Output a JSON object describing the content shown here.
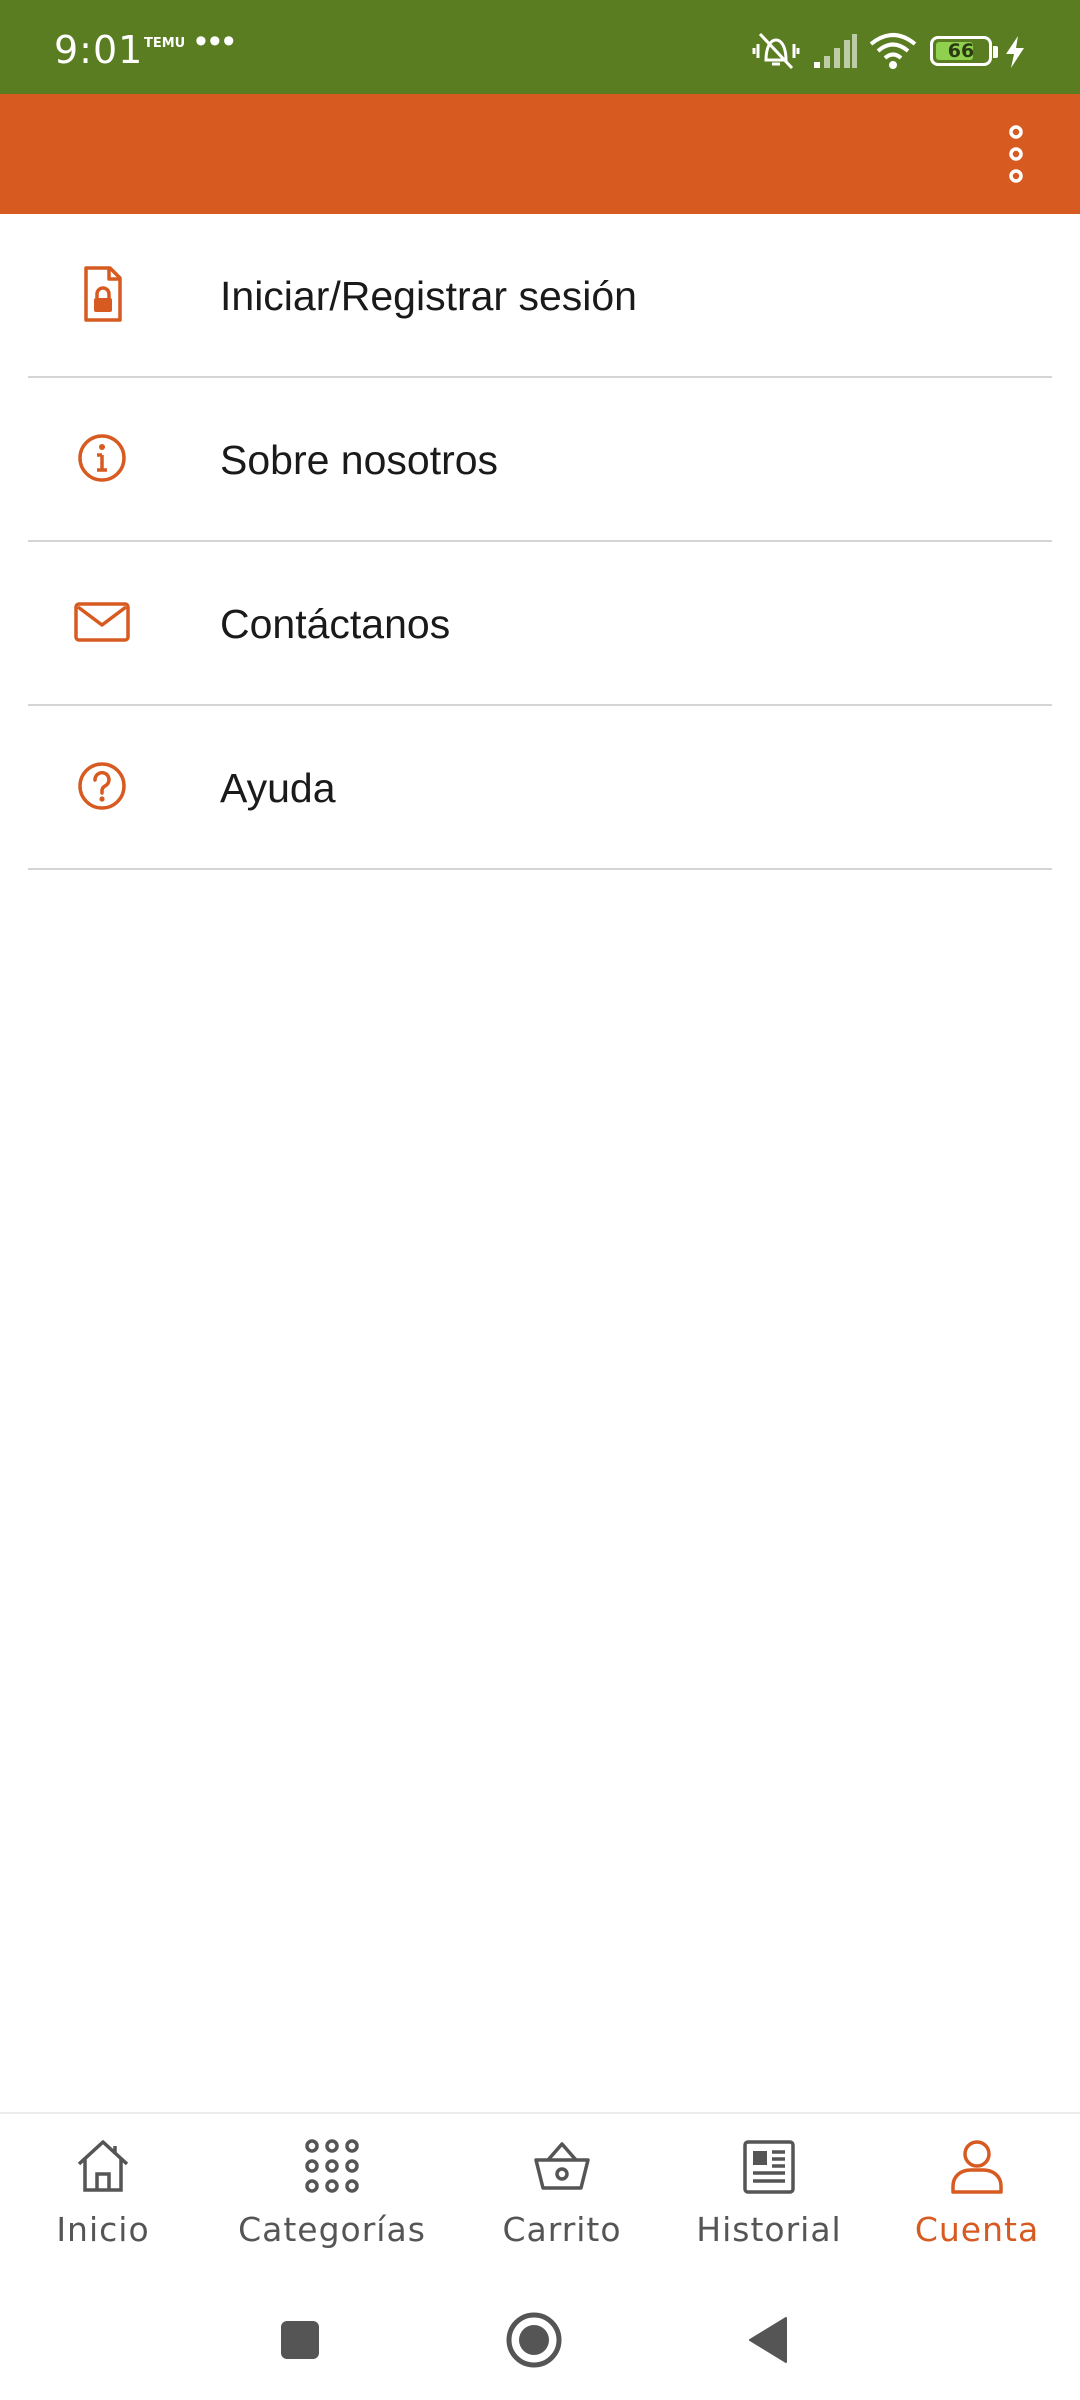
{
  "status_bar": {
    "time": "9:01",
    "notification_app": "TEMU",
    "more_notifications": "•••",
    "battery_level": "66",
    "icons": [
      "temu-notification-icon",
      "vibrate-silent-icon",
      "signal-icon",
      "wifi-icon",
      "battery-icon",
      "charging-icon"
    ]
  },
  "app_bar": {
    "background": "#d75a20",
    "menu_icon": "more-vert-icon"
  },
  "menu": {
    "items": [
      {
        "label": "Iniciar/Registrar sesión",
        "icon": "locked-document-icon"
      },
      {
        "label": "Sobre nosotros",
        "icon": "info-icon"
      },
      {
        "label": "Contáctanos",
        "icon": "mail-icon"
      },
      {
        "label": "Ayuda",
        "icon": "help-icon"
      }
    ]
  },
  "bottom_nav": {
    "items": [
      {
        "label": "Inicio",
        "icon": "home-icon"
      },
      {
        "label": "Categorías",
        "icon": "grid-icon"
      },
      {
        "label": "Carrito",
        "icon": "basket-icon"
      },
      {
        "label": "Historial",
        "icon": "newspaper-icon"
      },
      {
        "label": "Cuenta",
        "icon": "user-icon"
      }
    ],
    "active": "Cuenta"
  },
  "system_nav": {
    "buttons": [
      "recents-icon",
      "home-circle-icon",
      "back-icon"
    ]
  },
  "colors": {
    "status_bar": "#5a7d22",
    "accent": "#d75a20",
    "nav_inactive": "#555555"
  }
}
